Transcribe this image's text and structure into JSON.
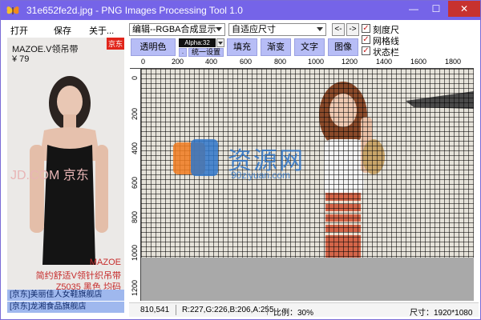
{
  "window": {
    "title": "31e652fe2d.jpg - PNG Images Processing Tool 1.0",
    "controls": {
      "minimize": "—",
      "maximize": "☐",
      "close": "✕"
    }
  },
  "menu": {
    "open": "打开",
    "save": "保存",
    "about": "关于..."
  },
  "preview": {
    "title": "MAZOE.V领吊带",
    "price": "¥ 79",
    "jd_tag": "京东",
    "watermark": "JD.COM 京东",
    "caption_brand": "MAZOE",
    "caption_desc": "简约舒适V领针织吊带",
    "caption_code": "Z5035 黑色 均码",
    "shops": [
      "[京东]美丽佳人女鞋旗舰店",
      "[京东]龙湘食品旗舰店"
    ]
  },
  "toolbar": {
    "mode_select": "编辑--RGBA合成显示",
    "size_select": "自适应尺寸",
    "prev": "<-",
    "next": "->",
    "transparent": "透明色",
    "alpha_label": "Alpha:32",
    "dot": ".",
    "unify": "统一设置",
    "fill": "填充",
    "gradient": "渐变",
    "text": "文字",
    "image": "图像"
  },
  "options": {
    "ruler": "刻度尺",
    "grid": "网格线",
    "statusbar": "状态栏"
  },
  "ruler": {
    "top": [
      "0",
      "200",
      "400",
      "600",
      "800",
      "1000",
      "1200",
      "1400",
      "1600",
      "1800"
    ],
    "left": [
      "0",
      "200",
      "400",
      "600",
      "800",
      "1000",
      "1200"
    ]
  },
  "canvas": {
    "watermark": "资源网",
    "watermark_url": "90ziyuan.com"
  },
  "status": {
    "coords": "810,541",
    "color": "R:227,G:226,B:206,A:255",
    "zoom": "比例：30%",
    "size": "尺寸：1920*1080"
  },
  "colors": {
    "titlebar": "#7564e8",
    "button": "#b7bdf6",
    "shop_bg": "#9fb8ee",
    "accent_red": "#c62b2b"
  }
}
